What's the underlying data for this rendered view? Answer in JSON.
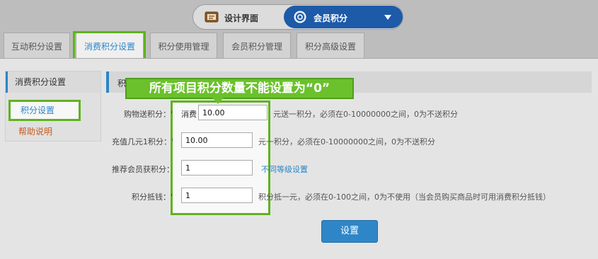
{
  "switcher": {
    "design_label": "设计界面",
    "member_label": "会员积分",
    "design_icon": "board-icon",
    "member_icon": "gear-icon",
    "accent": "#1d5aa8"
  },
  "tabs": [
    {
      "label": "互动积分设置",
      "active": false
    },
    {
      "label": "消费积分设置",
      "active": true
    },
    {
      "label": "积分使用管理",
      "active": false
    },
    {
      "label": "会员积分管理",
      "active": false
    },
    {
      "label": "积分高级设置",
      "active": false
    }
  ],
  "sidebar": {
    "title": "消费积分设置",
    "items": [
      {
        "label": "积分设置",
        "active": true
      },
      {
        "label": "帮助说明",
        "active": false
      }
    ]
  },
  "content": {
    "section_title": "积",
    "callout": "所有项目积分数量不能设置为“0”",
    "rows": [
      {
        "label": "购物送积分：'",
        "prefix": "消费",
        "value": "10.00",
        "hint": "元送一积分，必须在0-10000000之间，0为不送积分"
      },
      {
        "label": "充值几元1积分：'",
        "value": "10.00",
        "hint": "元一积分，必须在0-10000000之间，0为不送积分"
      },
      {
        "label": "推荐会员获积分：",
        "value": "1",
        "link": "不同等级设置"
      },
      {
        "label": "积分抵钱：'",
        "value": "1",
        "hint": "积分抵一元，必须在0-100之间，0为不使用（当会员购买商品时可用消费积分抵钱）"
      }
    ],
    "save_label": "设置"
  },
  "colors": {
    "highlight": "#5fb31f",
    "link": "#2b86c7",
    "help": "#c85a1c",
    "button": "#2f86c7"
  }
}
